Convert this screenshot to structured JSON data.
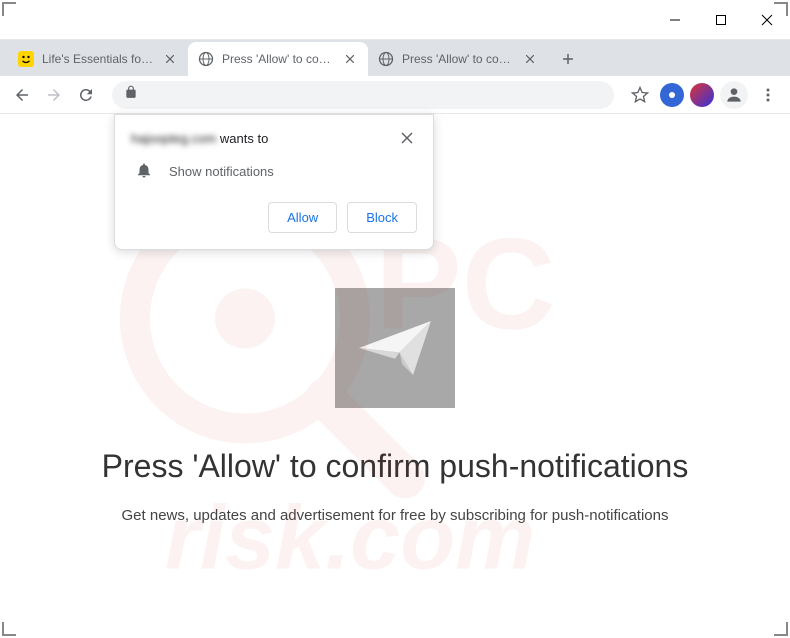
{
  "tabs": [
    {
      "title": "Life's Essentials for Effort…",
      "favicon": "smiley-yellow"
    },
    {
      "title": "Press 'Allow' to confirm p…",
      "favicon": "globe"
    },
    {
      "title": "Press 'Allow' to confirm p…",
      "favicon": "globe"
    }
  ],
  "active_tab_index": 1,
  "permission_popup": {
    "site": "hajoopteg.com",
    "wants_to": "wants to",
    "permission_label": "Show notifications",
    "allow_label": "Allow",
    "block_label": "Block"
  },
  "page": {
    "heading": "Press 'Allow' to confirm push-notifications",
    "subtext": "Get news, updates and advertisement for free by subscribing for push-notifications"
  },
  "watermark_text": "pcrisk.com"
}
